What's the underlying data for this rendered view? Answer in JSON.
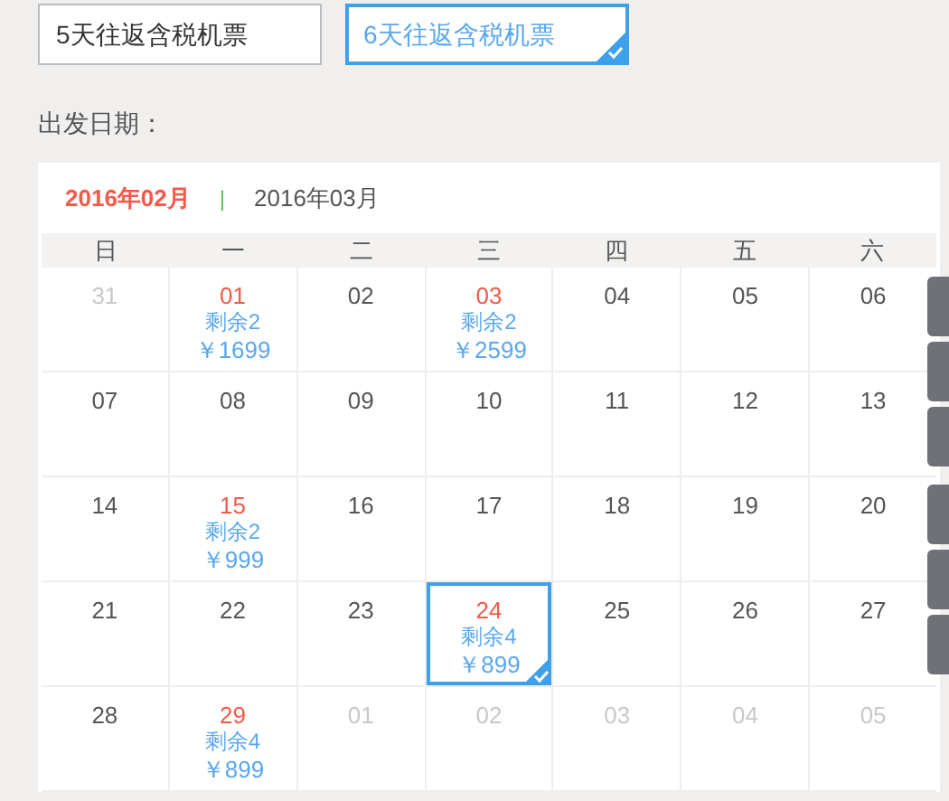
{
  "options": [
    {
      "label": "5天往返含税机票",
      "selected": false
    },
    {
      "label": "6天往返含税机票",
      "selected": true
    }
  ],
  "date_label": "出发日期：",
  "month_tabs": [
    {
      "label": "2016年02月",
      "selected": true
    },
    {
      "label": "2016年03月",
      "selected": false
    }
  ],
  "separator": "|",
  "weekdays": [
    "日",
    "一",
    "二",
    "三",
    "四",
    "五",
    "六"
  ],
  "days": [
    {
      "day": "31",
      "kind": "other",
      "selected": false
    },
    {
      "day": "01",
      "kind": "available",
      "remaining": "剩余2",
      "price": "￥1699",
      "selected": false
    },
    {
      "day": "02",
      "kind": "normal",
      "selected": false
    },
    {
      "day": "03",
      "kind": "available",
      "remaining": "剩余2",
      "price": "￥2599",
      "selected": false
    },
    {
      "day": "04",
      "kind": "normal",
      "selected": false
    },
    {
      "day": "05",
      "kind": "normal",
      "selected": false
    },
    {
      "day": "06",
      "kind": "normal",
      "selected": false
    },
    {
      "day": "07",
      "kind": "normal",
      "selected": false
    },
    {
      "day": "08",
      "kind": "normal",
      "selected": false
    },
    {
      "day": "09",
      "kind": "normal",
      "selected": false
    },
    {
      "day": "10",
      "kind": "normal",
      "selected": false
    },
    {
      "day": "11",
      "kind": "normal",
      "selected": false
    },
    {
      "day": "12",
      "kind": "normal",
      "selected": false
    },
    {
      "day": "13",
      "kind": "normal",
      "selected": false
    },
    {
      "day": "14",
      "kind": "normal",
      "selected": false
    },
    {
      "day": "15",
      "kind": "available",
      "remaining": "剩余2",
      "price": "￥999",
      "selected": false
    },
    {
      "day": "16",
      "kind": "normal",
      "selected": false
    },
    {
      "day": "17",
      "kind": "normal",
      "selected": false
    },
    {
      "day": "18",
      "kind": "normal",
      "selected": false
    },
    {
      "day": "19",
      "kind": "normal",
      "selected": false
    },
    {
      "day": "20",
      "kind": "normal",
      "selected": false
    },
    {
      "day": "21",
      "kind": "normal",
      "selected": false
    },
    {
      "day": "22",
      "kind": "normal",
      "selected": false
    },
    {
      "day": "23",
      "kind": "normal",
      "selected": false
    },
    {
      "day": "24",
      "kind": "available",
      "remaining": "剩余4",
      "price": "￥899",
      "selected": true
    },
    {
      "day": "25",
      "kind": "normal",
      "selected": false
    },
    {
      "day": "26",
      "kind": "normal",
      "selected": false
    },
    {
      "day": "27",
      "kind": "normal",
      "selected": false
    },
    {
      "day": "28",
      "kind": "normal",
      "selected": false
    },
    {
      "day": "29",
      "kind": "available",
      "remaining": "剩余4",
      "price": "￥899",
      "selected": false
    },
    {
      "day": "01",
      "kind": "other",
      "selected": false
    },
    {
      "day": "02",
      "kind": "other",
      "selected": false
    },
    {
      "day": "03",
      "kind": "other",
      "selected": false
    },
    {
      "day": "04",
      "kind": "other",
      "selected": false
    },
    {
      "day": "05",
      "kind": "other",
      "selected": false
    }
  ]
}
